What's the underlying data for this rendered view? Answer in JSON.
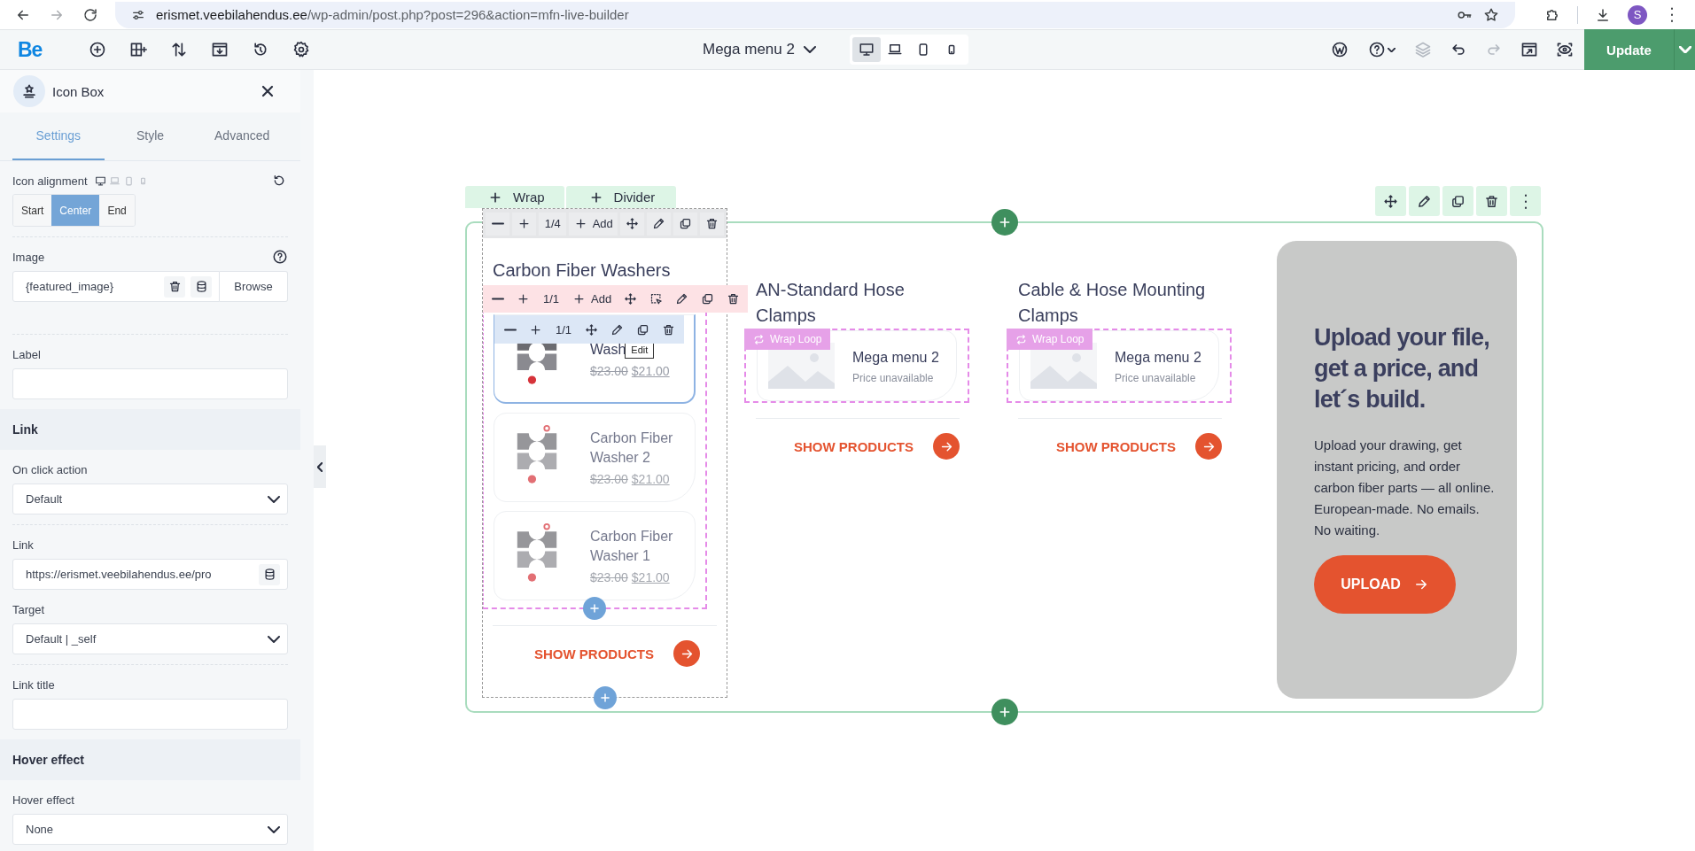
{
  "browser": {
    "domain": "erismet.veebilahendus.ee",
    "path": "/wp-admin/post.php?post=296&action=mfn-live-builder",
    "avatar": "S"
  },
  "builder_bar": {
    "logo": "Be",
    "tools": [
      {
        "kind": "add"
      },
      {
        "kind": "layout"
      },
      {
        "kind": "sort"
      },
      {
        "kind": "export"
      },
      {
        "kind": "history"
      },
      {
        "kind": "settings"
      }
    ],
    "page": "Mega menu 2",
    "devices": [
      {
        "kind": "desktop",
        "selected": true
      },
      {
        "kind": "laptop",
        "selected": false
      },
      {
        "kind": "tablet",
        "selected": false
      },
      {
        "kind": "phone",
        "selected": false
      }
    ],
    "actions": [
      {
        "kind": "wordpress",
        "disabled": false
      },
      {
        "kind": "help",
        "disabled": false
      },
      {
        "kind": "layers",
        "disabled": true
      },
      {
        "kind": "undo",
        "disabled": false
      },
      {
        "kind": "redo",
        "disabled": true
      },
      {
        "kind": "preview",
        "disabled": false
      },
      {
        "kind": "eye",
        "disabled": false
      }
    ],
    "update": "Update"
  },
  "panel": {
    "title": "Icon Box",
    "tabs": [
      {
        "label": "Settings",
        "selected": true
      },
      {
        "label": "Style",
        "selected": false
      },
      {
        "label": "Advanced",
        "selected": false
      }
    ],
    "fields": [
      {
        "kind": "alignment",
        "label": "Icon alignment",
        "options": [
          {
            "label": "Start",
            "selected": false
          },
          {
            "label": "Center",
            "selected": true
          },
          {
            "label": "End",
            "selected": false
          }
        ]
      },
      {
        "kind": "separator"
      },
      {
        "kind": "image",
        "label": "Image",
        "value": "{featured_image}",
        "button": "Browse"
      },
      {
        "kind": "separator"
      },
      {
        "kind": "text",
        "label": "Label"
      },
      {
        "kind": "section",
        "title": "Link"
      },
      {
        "kind": "select",
        "label": "On click action",
        "value": "Default"
      },
      {
        "kind": "separator"
      },
      {
        "kind": "dynamic",
        "label": "Link",
        "value": "https://erismet.veebilahendus.ee/pro"
      },
      {
        "kind": "select",
        "label": "Target",
        "value": "Default | _self"
      },
      {
        "kind": "separator"
      },
      {
        "kind": "text",
        "label": "Link title"
      },
      {
        "kind": "section",
        "title": "Hover effect"
      },
      {
        "kind": "select",
        "label": "Hover effect",
        "value": "None"
      }
    ]
  },
  "canvas": {
    "add_tags": [
      {
        "label": "Wrap"
      },
      {
        "label": "Divider"
      }
    ],
    "section_tools": [
      {
        "kind": "move"
      },
      {
        "kind": "edit"
      },
      {
        "kind": "duplicate"
      },
      {
        "kind": "delete"
      },
      {
        "kind": "more"
      }
    ],
    "columns": [
      {
        "selected": true,
        "toolbar": {
          "size": "1/4",
          "add": "Add",
          "tools": [
            {
              "kind": "move"
            },
            {
              "kind": "edit"
            },
            {
              "kind": "duplicate"
            },
            {
              "kind": "delete"
            }
          ]
        },
        "title": "Carbon Fiber Washers",
        "loop": {
          "selected": true,
          "toolbar": {
            "size": "1/1",
            "add": "Add",
            "tools": [
              {
                "kind": "move"
              },
              {
                "kind": "select"
              },
              {
                "kind": "edit"
              },
              {
                "kind": "duplicate"
              },
              {
                "kind": "delete"
              }
            ]
          },
          "items": [
            {
              "kind": "photo",
              "name": "Wash",
              "old_price": "$23.00",
              "price": "$21.00",
              "selected": true,
              "dimmed": false,
              "toolbar": {
                "size": "1/1",
                "tools": [
                  {
                    "kind": "move"
                  },
                  {
                    "kind": "edit"
                  },
                  {
                    "kind": "duplicate"
                  },
                  {
                    "kind": "delete"
                  }
                ]
              },
              "tooltip": "Edit"
            },
            {
              "kind": "photo",
              "name": "Carbon Fiber Washer 2",
              "old_price": "$23.00",
              "price": "$21.00",
              "selected": false,
              "dimmed": true
            },
            {
              "kind": "photo",
              "name": "Carbon Fiber Washer 1",
              "old_price": "$23.00",
              "price": "$21.00",
              "selected": false,
              "dimmed": true
            }
          ]
        },
        "link": "SHOW PRODUCTS"
      },
      {
        "selected": false,
        "title": "AN-Standard Hose Clamps",
        "loop": {
          "selected": false,
          "tag": "Wrap Loop",
          "items": [
            {
              "kind": "placeholder",
              "name": "Mega menu 2",
              "note": "Price unavailable",
              "selected": false,
              "dimmed": false
            }
          ]
        },
        "link": "SHOW PRODUCTS"
      },
      {
        "selected": false,
        "title": "Cable & Hose Mounting Clamps",
        "loop": {
          "selected": false,
          "tag": "Wrap Loop",
          "items": [
            {
              "kind": "placeholder",
              "name": "Mega menu 2",
              "note": "Price unavailable",
              "selected": false,
              "dimmed": false
            }
          ]
        },
        "link": "SHOW PRODUCTS"
      }
    ],
    "promo": {
      "heading": "Upload your file, get a price, and let´s build.",
      "text": "Upload your drawing, get instant pricing, and order carbon fiber parts — all online. European-made. No emails. No waiting.",
      "button": "UPLOAD"
    }
  }
}
